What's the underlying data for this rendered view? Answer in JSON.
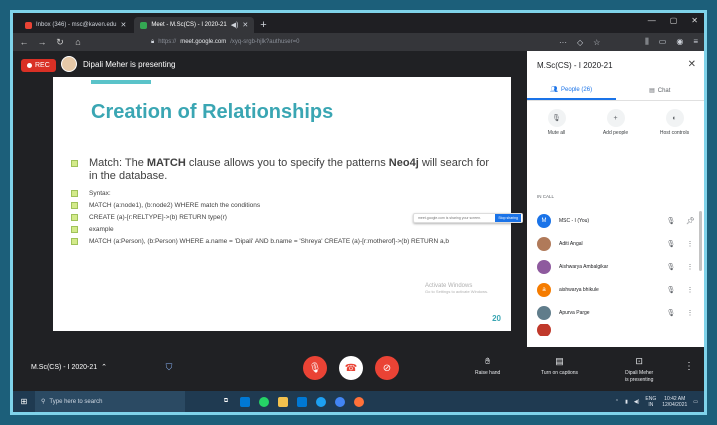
{
  "browser": {
    "tabs": [
      {
        "label": "Inbox (346) - msc@kaven.edu",
        "favicon_color": "#ea4335",
        "active": false
      },
      {
        "label": "Meet - M.Sc(CS) - I 2020-21",
        "favicon_color": "#34a853",
        "active": true
      }
    ],
    "new_tab": "+",
    "url_prefix": "https://",
    "url_host": "meet.google.com",
    "url_path": "/xyq-srgb-hjlk?authuser=0"
  },
  "meet": {
    "rec_label": "REC",
    "presenter_text": "Dipali Meher is presenting",
    "slide": {
      "title": "Creation of Relationships",
      "bullets": [
        {
          "text_before": "Match: The ",
          "bold1": "MATCH",
          "text_mid": " clause allows you to specify the patterns ",
          "bold2": "Neo4j",
          "text_after": " will search for in the database.",
          "big": true
        },
        {
          "text": "Syntax:"
        },
        {
          "text": "MATCH (a:node1), (b:node2) WHERE match the conditions"
        },
        {
          "text": "CREATE (a)-[r:RELTYPE]->(b) RETURN type(r)"
        },
        {
          "text": "example"
        },
        {
          "text": "MATCH (a:Person), (b:Person) WHERE a.name = 'Dipali' AND b.name = 'Shreya' CREATE (a)-[r:motherof]->(b) RETURN a,b"
        }
      ],
      "share_pill_text": "meet.google.com is sharing your screen.",
      "share_pill_button": "Stop sharing",
      "watermark_line1": "Activate Windows",
      "watermark_line2": "Go to Settings to activate Windows.",
      "page_number": "20"
    }
  },
  "panel": {
    "title": "M.Sc(CS) - I 2020-21",
    "tabs": [
      {
        "label": "People (26)",
        "icon": "people-icon",
        "active": true
      },
      {
        "label": "Chat",
        "icon": "chat-icon",
        "active": false
      }
    ],
    "actions": [
      {
        "label": "Mute all",
        "icon": "mic-off-icon"
      },
      {
        "label": "Add people",
        "icon": "add-person-icon"
      },
      {
        "label": "Host controls",
        "icon": "toggle-icon"
      }
    ],
    "section_label": "IN CALL",
    "participants": [
      {
        "name": "MSC - I (You)",
        "initial": "M",
        "color": "#1a73e8",
        "photo": false
      },
      {
        "name": "Aditi Angal",
        "initial": "",
        "color": "#b07a5a",
        "photo": true
      },
      {
        "name": "Aishwarya Ambalgikar",
        "initial": "",
        "color": "#8e5a9e",
        "photo": true
      },
      {
        "name": "aishwarya bhikule",
        "initial": "a",
        "color": "#f57c00",
        "photo": false
      },
      {
        "name": "Apurva Parge",
        "initial": "",
        "color": "#607d8b",
        "photo": true
      },
      {
        "name": "",
        "initial": "",
        "color": "#c0392b",
        "photo": true
      }
    ]
  },
  "bottom": {
    "meeting_name": "M.Sc(CS) - I 2020-21",
    "raise_hand": "Raise hand",
    "captions": "Turn on captions",
    "presenting_line1": "Dipali Meher",
    "presenting_line2": "is presenting"
  },
  "taskbar": {
    "search_placeholder": "Type here to search",
    "lang_line1": "ENG",
    "lang_line2": "IN",
    "time": "10:42 AM",
    "date": "12/04/2021"
  }
}
